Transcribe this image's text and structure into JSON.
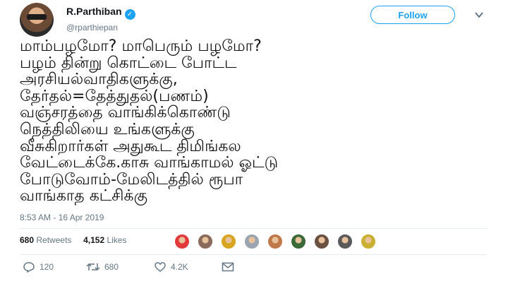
{
  "author": {
    "display_name": "R.Parthiban",
    "handle": "@rparthiepan",
    "verified_glyph": "✓"
  },
  "follow_label": "Follow",
  "tweet_text": "மாம்பழமோ? மாபெரும் பழமோ?\nபழம் தின்று கொட்டை போட்ட\nஅரசியல்வாதிகளுக்கு,\nதேர்தல்=தேத்துதல்(பணம்)\nவஞ்சரத்தை வாங்கிக்கொண்டு\nநெத்திலியை உங்களுக்கு\nவீசுகிறார்கள் அதுகூட திமிங்கல\nவேட்டைக்கே.காசு வாங்காமல் ஓட்டு\nபோடுவோம்-மேலிடத்தில் ரூபா\nவாங்காத கட்சிக்கு",
  "timestamp": "8:53 AM - 16 Apr 2019",
  "stats": {
    "retweets_count": "680",
    "retweets_label": "Retweets",
    "likes_count": "4,152",
    "likes_label": "Likes"
  },
  "liker_avatar_colors": [
    "#e23a3a",
    "#8a6a5a",
    "#d9a520",
    "#9aa5b1",
    "#c07a4a",
    "#3a6a3a",
    "#6a5040",
    "#5a5a5a",
    "#c9b030"
  ],
  "actions": {
    "replies": "120",
    "retweets": "680",
    "likes": "4.2K"
  },
  "icons": {
    "reply": "reply-icon",
    "retweet": "retweet-icon",
    "like": "heart-icon",
    "message": "envelope-icon",
    "menu": "chevron-down-icon"
  },
  "colors": {
    "accent": "#1da1f2",
    "secondary_text": "#657786"
  }
}
